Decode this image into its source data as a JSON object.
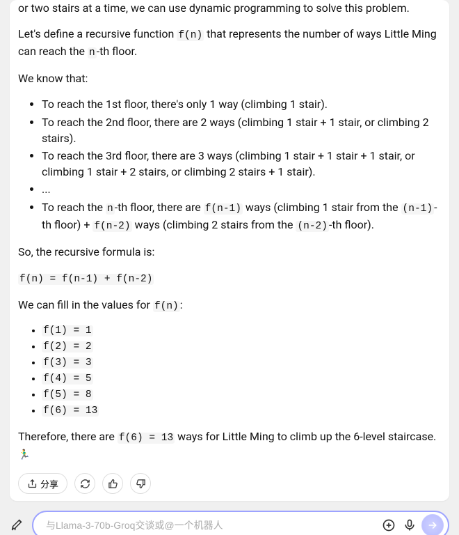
{
  "content": {
    "intro_fragment": "or two stairs at a time, we can use dynamic programming to solve this problem.",
    "define_pre": "Let's define a recursive function ",
    "define_code": "f(n)",
    "define_mid": " that represents the number of ways Little Ming can reach the ",
    "define_code2": "n",
    "define_post": "-th floor.",
    "we_know": "We know that:",
    "rules": {
      "r1": "To reach the 1st floor, there's only 1 way (climbing 1 stair).",
      "r2": "To reach the 2nd floor, there are 2 ways (climbing 1 stair + 1 stair, or climbing 2 stairs).",
      "r3": "To reach the 3rd floor, there are 3 ways (climbing 1 stair + 1 stair + 1 stair, or climbing 1 stair + 2 stairs, or climbing 2 stairs + 1 stair).",
      "r4": "...",
      "r5_a": "To reach the ",
      "r5_n": "n",
      "r5_b": "-th floor, there are ",
      "r5_c1": "f(n-1)",
      "r5_c": " ways (climbing 1 stair from the ",
      "r5_c2": "(n-1)",
      "r5_d": "-th floor) + ",
      "r5_c3": "f(n-2)",
      "r5_e": " ways (climbing 2 stairs from the ",
      "r5_c4": "(n-2)",
      "r5_f": "-th floor)."
    },
    "so": "So, the recursive formula is:",
    "formula": "f(n) = f(n-1) + f(n-2)",
    "fill_a": "We can fill in the values for ",
    "fill_code": "f(n)",
    "fill_b": ":",
    "values": {
      "v1": "f(1) = 1",
      "v2": "f(2) = 2",
      "v3": "f(3) = 3",
      "v4": "f(4) = 5",
      "v5": "f(5) = 8",
      "v6": "f(6) = 13"
    },
    "conclusion_a": "Therefore, there are ",
    "conclusion_code": "f(6) = 13",
    "conclusion_b": " ways for Little Ming to climb up the 6-level staircase.",
    "robot": "🏃‍♂️"
  },
  "actions": {
    "share": "分享"
  },
  "input": {
    "placeholder": "与Llama-3-70b-Groq交谈或@一个机器人"
  }
}
